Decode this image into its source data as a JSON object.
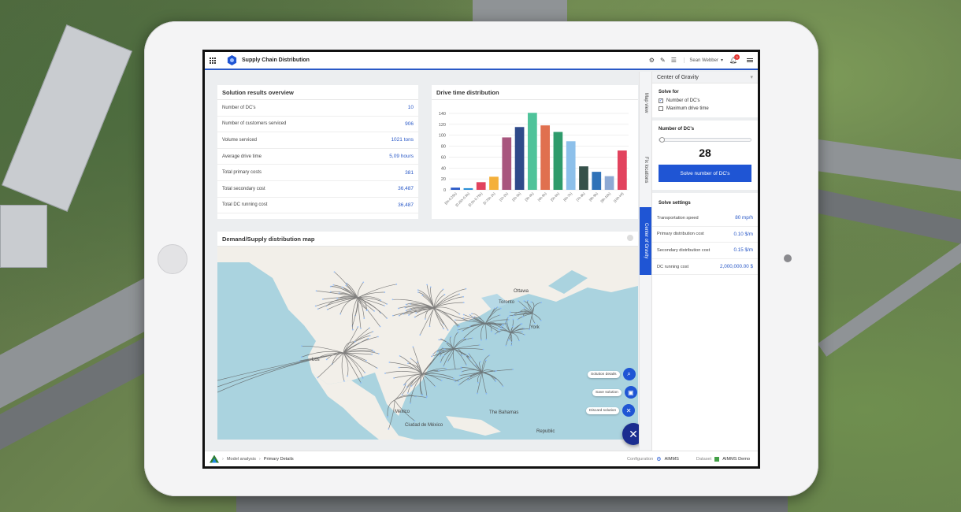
{
  "app": {
    "title": "Supply Chain Distribution",
    "user": "Sean Webber",
    "notifications": "3"
  },
  "results": {
    "title": "Solution results overview",
    "rows": [
      {
        "label": "Number of DC's",
        "value": "10"
      },
      {
        "label": "Number of customers serviced",
        "value": "906"
      },
      {
        "label": "Volume serviced",
        "value": "1021 tons"
      },
      {
        "label": "Average drive time",
        "value": "5,09 hours"
      },
      {
        "label": "Total primary costs",
        "value": "381"
      },
      {
        "label": "Total secondary cost",
        "value": "36,487"
      },
      {
        "label": "Total DC running cost",
        "value": "36,487"
      }
    ]
  },
  "chart_data": {
    "type": "bar",
    "title": "Drive time distribution",
    "categories": [
      "[0h-0.25h)",
      "[0.25h-0.5h)",
      "[0.5h-0.75h)",
      "[0.75h-1h)",
      "[1h-2h)",
      "[2h-3h)",
      "[3h-4h)",
      "[4h-5h)",
      "[5h-6h)",
      "[6h-7h)",
      "[7h-8h)",
      "[8h-9h)",
      "[9h-10h)",
      "[10h-inf)"
    ],
    "values": [
      4,
      3,
      14,
      24,
      96,
      115,
      141,
      118,
      106,
      89,
      43,
      33,
      25,
      72
    ],
    "colors": [
      "#2a59c7",
      "#2a8fd6",
      "#e2435e",
      "#f4b03a",
      "#a8567e",
      "#2f4a8a",
      "#4fc39a",
      "#e0704f",
      "#2e9b6b",
      "#8dc0ea",
      "#36514a",
      "#2f72b8",
      "#8eaad4",
      "#e2435e"
    ],
    "ylim": [
      0,
      150
    ],
    "yticks": [
      0,
      20,
      40,
      60,
      80,
      100,
      120,
      140
    ],
    "grid": true
  },
  "map": {
    "title": "Demand/Supply distribution map",
    "cities": [
      "Ottawa",
      "Toronto",
      "York",
      "Los",
      "México",
      "Ciudad de México",
      "The Bahamas",
      "Republic"
    ]
  },
  "actions": {
    "details": "Solution details",
    "save": "Save solution",
    "discard": "Discard solution"
  },
  "tabs": {
    "map_view": "Map view",
    "fix_locations": "Fix locations",
    "center_gravity": "Center of Gravity"
  },
  "panel": {
    "title": "Center of Gravity",
    "solve_for": "Solve for",
    "option1": "Number of DC's",
    "option2": "Maximum drive time",
    "num_dcs_label": "Number of DC's",
    "num_dcs_value": "28",
    "slider_fraction": 0.0,
    "solve_button": "Solve number of DC's",
    "settings_title": "Solve settings",
    "settings": [
      {
        "label": "Transportation speed",
        "value": "80 mp/h"
      },
      {
        "label": "Primary distribution cost",
        "value": "0.10 $/m"
      },
      {
        "label": "Secondary distribution cost",
        "value": "0.15 $/m"
      },
      {
        "label": "DC running cost",
        "value": "2,000,000.00 $"
      }
    ]
  },
  "footer": {
    "crumb1": "Model analysis",
    "crumb2": "Primary Details",
    "config_label": "Configuration",
    "config_value": "AIMMS",
    "dataset_label": "Dataset",
    "dataset_value": "AIMMS Demo"
  }
}
